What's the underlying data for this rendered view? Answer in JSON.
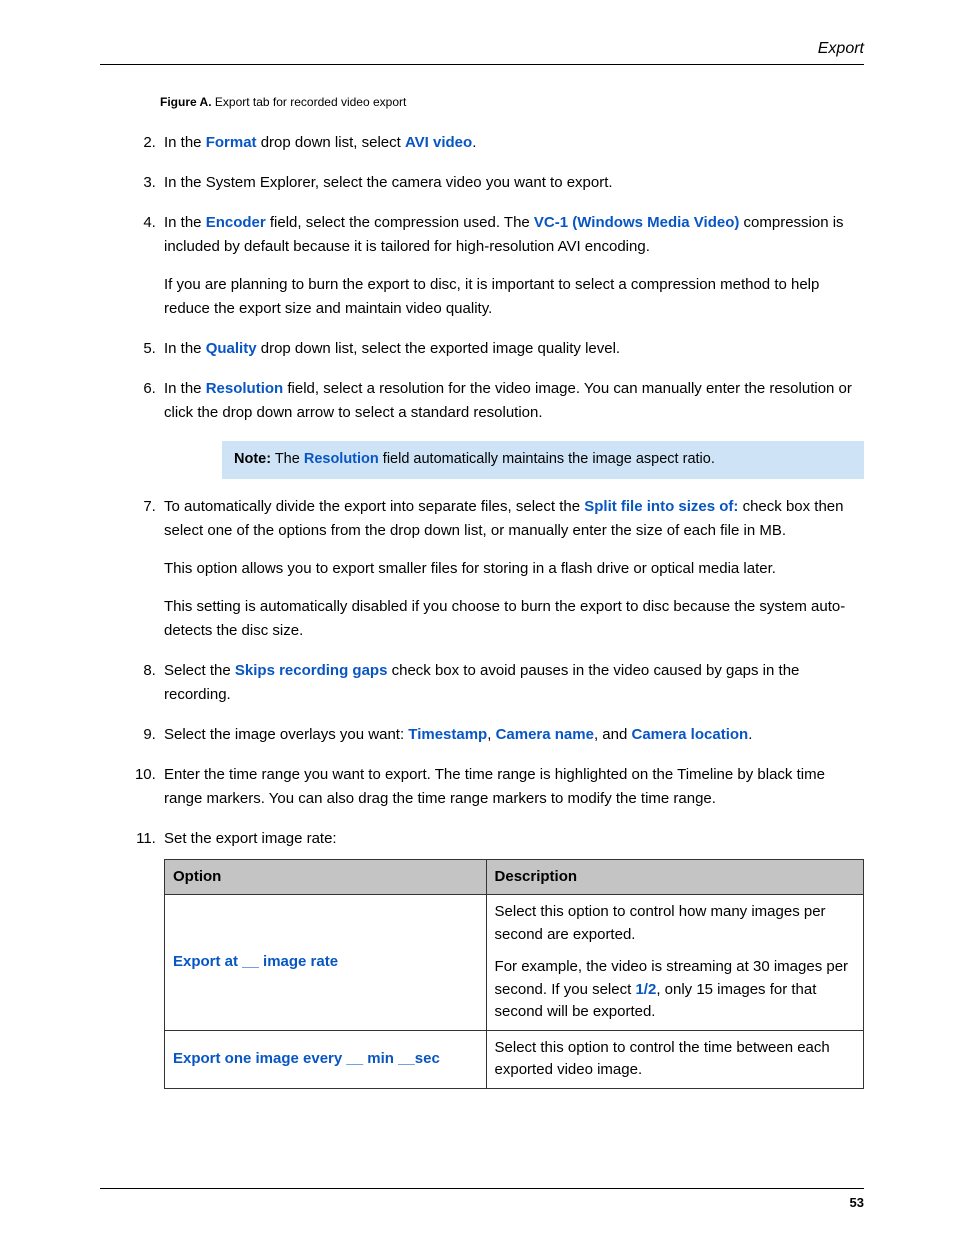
{
  "header": {
    "section": "Export"
  },
  "figure": {
    "label": "Figure A.",
    "caption": " Export tab for recorded video export"
  },
  "steps": {
    "s2": {
      "pre": "In the ",
      "b1": "Format",
      "mid": " drop down list, select ",
      "b2": "AVI video",
      "post": "."
    },
    "s3": "In the System Explorer, select the camera video you want to export.",
    "s4": {
      "pre": "In the ",
      "b1": "Encoder",
      "mid": " field, select the compression used. The ",
      "b2": "VC-1 (Windows Media Video)",
      "post": " compression is included by default because it is tailored for high-resolution AVI encoding.",
      "p2": "If you are planning to burn the export to disc, it is important to select a compression method to help reduce the export size and maintain video quality."
    },
    "s5": {
      "pre": "In the ",
      "b1": "Quality",
      "post": " drop down list, select the exported image quality level."
    },
    "s6": {
      "pre": "In the ",
      "b1": "Resolution",
      "post": " field, select a resolution for the video image. You can manually enter the resolution or click the drop down arrow to select a standard resolution.",
      "note_label": "Note:",
      "note_pre": "   The ",
      "note_b": "Resolution",
      "note_post": " field automatically maintains the image aspect ratio."
    },
    "s7": {
      "pre": "To automatically divide the export into separate files, select the ",
      "b1": "Split file into sizes of:",
      "post": " check box then select one of the options from the drop down list, or manually enter the size of each file in MB.",
      "p2": "This option allows you to export smaller files for storing in a flash drive or optical media later.",
      "p3": "This setting is automatically disabled if you choose to burn the export to disc because the system auto-detects the disc size."
    },
    "s8": {
      "pre": "Select the ",
      "b1": "Skips recording gaps",
      "post": " check box to avoid pauses in the video caused by gaps in the recording."
    },
    "s9": {
      "pre": "Select the image overlays you want: ",
      "b1": "Timestamp",
      "sep1": ", ",
      "b2": "Camera name",
      "sep2": ", and ",
      "b3": "Camera location",
      "post": "."
    },
    "s10": "Enter the time range you want to export. The time range is highlighted on the Timeline by black time range markers. You can also drag the time range markers to modify the time range.",
    "s11": {
      "lead": "Set the export image rate:"
    }
  },
  "table": {
    "h1": "Option",
    "h2": "Description",
    "r1": {
      "opt": "Export at __ image rate",
      "d1": "Select this option to control how many images per second are exported.",
      "d2a": "For example, the video is streaming at 30 images per second. If you select ",
      "d2b": "1/2",
      "d2c": ", only 15 images for that second will be exported."
    },
    "r2": {
      "opt": "Export one image every __ min __sec",
      "d": "Select this option to control the time between each exported video image."
    }
  },
  "footer": {
    "page": "53"
  }
}
